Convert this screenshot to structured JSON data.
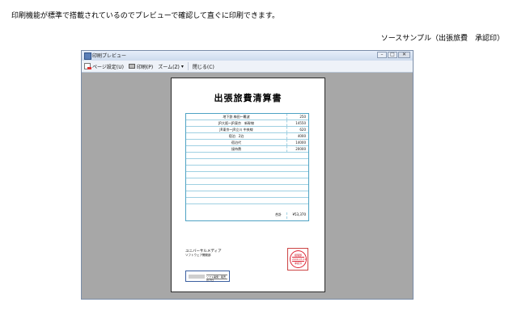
{
  "page": {
    "caption": "印刷機能が標準で搭載されているのでプレビューで確認して直ぐに印刷できます。",
    "subcaption": "ソースサンプル（出張旅費　承認印）"
  },
  "window": {
    "title": "印刷プレビュー",
    "buttons": {
      "minimize": "–",
      "maximize": "□",
      "close": "✕"
    }
  },
  "toolbar": {
    "page_setup": "ページ設定(U)",
    "print": "印刷(P)",
    "zoom": "ズーム(Z)",
    "zoom_arrow": "▾",
    "close": "閉じる(C)"
  },
  "document": {
    "title": "出張旅費清算書",
    "rows": [
      {
        "desc": "地下鉄 梅田〜難波",
        "amount": "250"
      },
      {
        "desc": "JR大阪〜JR東京　新幹線",
        "amount": "14550"
      },
      {
        "desc": "JR東京〜JR立川 中央線",
        "amount": "620"
      },
      {
        "desc": "宿泊　2泊",
        "amount": "4000"
      },
      {
        "desc": "宿泊代",
        "amount": "14000"
      },
      {
        "desc": "接待費",
        "amount": "20000"
      },
      {
        "desc": "",
        "amount": ""
      },
      {
        "desc": "",
        "amount": ""
      },
      {
        "desc": "",
        "amount": ""
      },
      {
        "desc": "",
        "amount": ""
      },
      {
        "desc": "",
        "amount": ""
      },
      {
        "desc": "",
        "amount": ""
      },
      {
        "desc": "",
        "amount": ""
      },
      {
        "desc": "",
        "amount": ""
      }
    ],
    "total_label": "合計",
    "total_value": "¥53,370",
    "company_name": "ユニバーサルメディア",
    "company_sub": "ソフトウェア開発部",
    "stamp_top": "経理部",
    "stamp_mid": "2009.07.01",
    "stamp_bottom": "承認済",
    "banner_text": "ソフト開発・販売のプロ"
  },
  "colors": {
    "table_border": "#4fa3c4",
    "stamp_red": "#d22233",
    "viewport_bg": "#a7a7a7"
  }
}
